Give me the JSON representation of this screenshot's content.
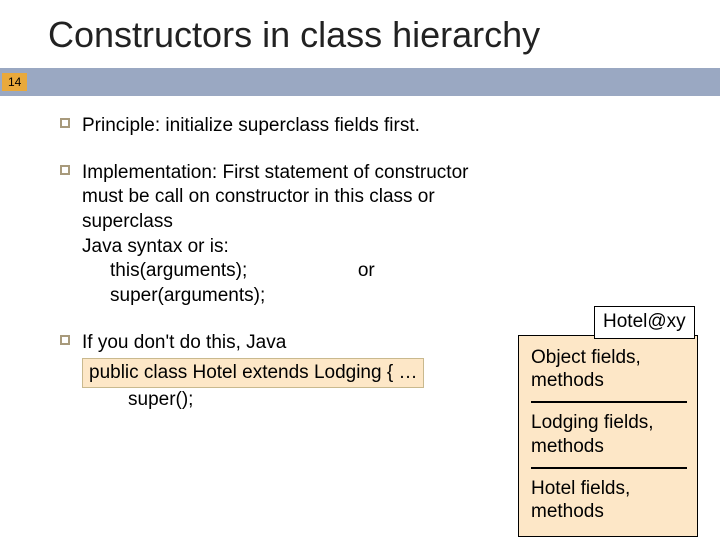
{
  "title": "Constructors in class hierarchy",
  "page_number": "14",
  "bullets": {
    "b1": "Principle: initialize superclass fields first.",
    "b2": {
      "line1": "Implementation: First statement of constructor must be call on constructor in this class or superclass",
      "line2": "Java syntax or is:",
      "this_line": "this(arguments);",
      "or": "or",
      "super_line": "super(arguments);"
    },
    "b3": {
      "intro": "If you don't do this, Java",
      "highlight": "public class Hotel extends Lodging { …",
      "super_call": "super();"
    }
  },
  "diagram": {
    "label": "Hotel@xy",
    "section1": "Object fields, methods",
    "section2": "Lodging fields, methods",
    "section3": "Hotel fields, methods"
  }
}
